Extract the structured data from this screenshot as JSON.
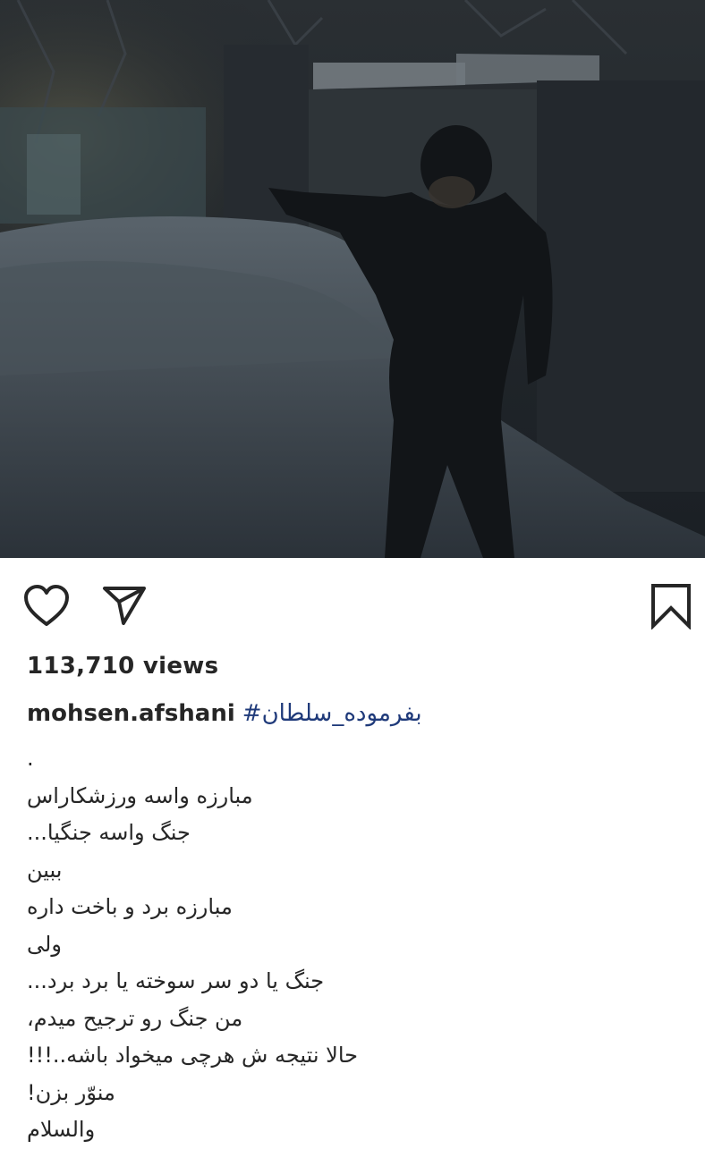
{
  "post": {
    "media": {
      "type": "video",
      "icon": "video-still"
    },
    "actions": {
      "like_icon": "heart-icon",
      "share_icon": "paper-plane-icon",
      "save_icon": "bookmark-icon"
    },
    "views_text": "113,710 views",
    "caption": {
      "username": "mohsen.afshani",
      "hashtag": "#بفرموده_سلطان",
      "lines": [
        ".",
        "مبارزه واسه ورزشکاراس",
        "جنگ واسه جنگیا...",
        "ببین",
        "مبارزه برد و باخت داره",
        "ولی",
        "جنگ یا دو سر سوخته یا برد برد...",
        "من جنگ رو ترجیح میدم،",
        "حالا نتیجه ش هرچی میخواد باشه..!!!",
        "منوّر بزن!",
        "والسلام"
      ]
    },
    "colors": {
      "text": "#262626",
      "hashtag": "#1f3a7a",
      "background": "#ffffff"
    }
  }
}
